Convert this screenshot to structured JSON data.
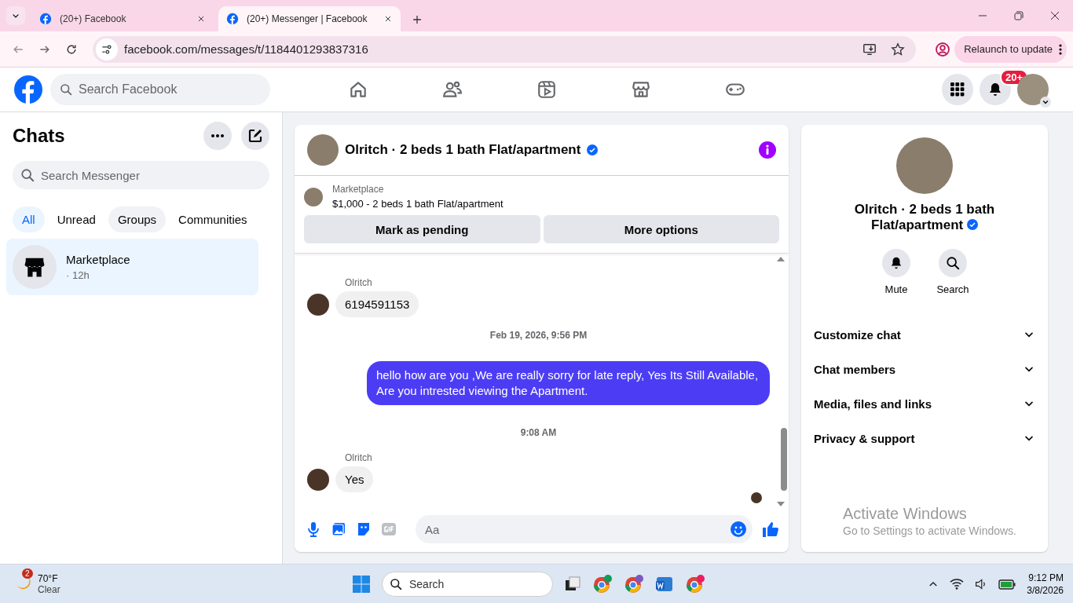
{
  "browser": {
    "tabs": [
      {
        "title": "(20+) Facebook",
        "selected": false
      },
      {
        "title": "(20+) Messenger | Facebook",
        "selected": true
      }
    ],
    "url": "facebook.com/messages/t/1184401293837316",
    "update_button": "Relaunch to update"
  },
  "facebook_bar": {
    "search": {
      "placeholder": "Search Facebook"
    },
    "notification_badge": "20+"
  },
  "chats": {
    "title": "Chats",
    "search": {
      "placeholder": "Search Messenger"
    },
    "filters": [
      {
        "label": "All",
        "selected": true,
        "hovered": false
      },
      {
        "label": "Unread",
        "selected": false,
        "hovered": false
      },
      {
        "label": "Groups",
        "selected": false,
        "hovered": true
      },
      {
        "label": "Communities",
        "selected": false,
        "hovered": false
      }
    ],
    "items": [
      {
        "name": "Marketplace",
        "time": "· 12h",
        "selected": true
      }
    ]
  },
  "conversation": {
    "title": "Olritch · 2 beds 1 bath Flat/apartment",
    "verified": true,
    "listing": {
      "label": "Marketplace",
      "title": "$1,000 - 2 beds 1 bath Flat/apartment"
    },
    "buttons": [
      "Mark as pending",
      "More options"
    ],
    "messages": [
      {
        "kind": "received",
        "sender": "Olritch",
        "text": "6194591153"
      },
      {
        "kind": "timestamp",
        "text": "Feb 19, 2026, 9:56 PM"
      },
      {
        "kind": "sent",
        "text": "hello how are you ,We are really sorry for late reply, Yes Its Still Available, Are you intrested viewing the Apartment."
      },
      {
        "kind": "timestamp",
        "text": "9:08 AM"
      },
      {
        "kind": "received",
        "sender": "Olritch",
        "text": "Yes"
      }
    ],
    "composer": {
      "placeholder": "Aa"
    }
  },
  "info": {
    "name": "Olritch · 2 beds 1 bath Flat/apartment",
    "verified": true,
    "actions": [
      "Mute",
      "Search"
    ],
    "sections": [
      "Customize chat",
      "Chat members",
      "Media, files and links",
      "Privacy & support"
    ]
  },
  "activation_notice": {
    "title": "Activate Windows",
    "text": "Go to Settings to activate Windows."
  },
  "taskbar": {
    "weather": {
      "badge": "2",
      "temperature": "70°F",
      "condition": "Clear"
    },
    "search": {
      "placeholder": "Search"
    },
    "time": "9:12 PM",
    "date": "3/8/2026"
  }
}
